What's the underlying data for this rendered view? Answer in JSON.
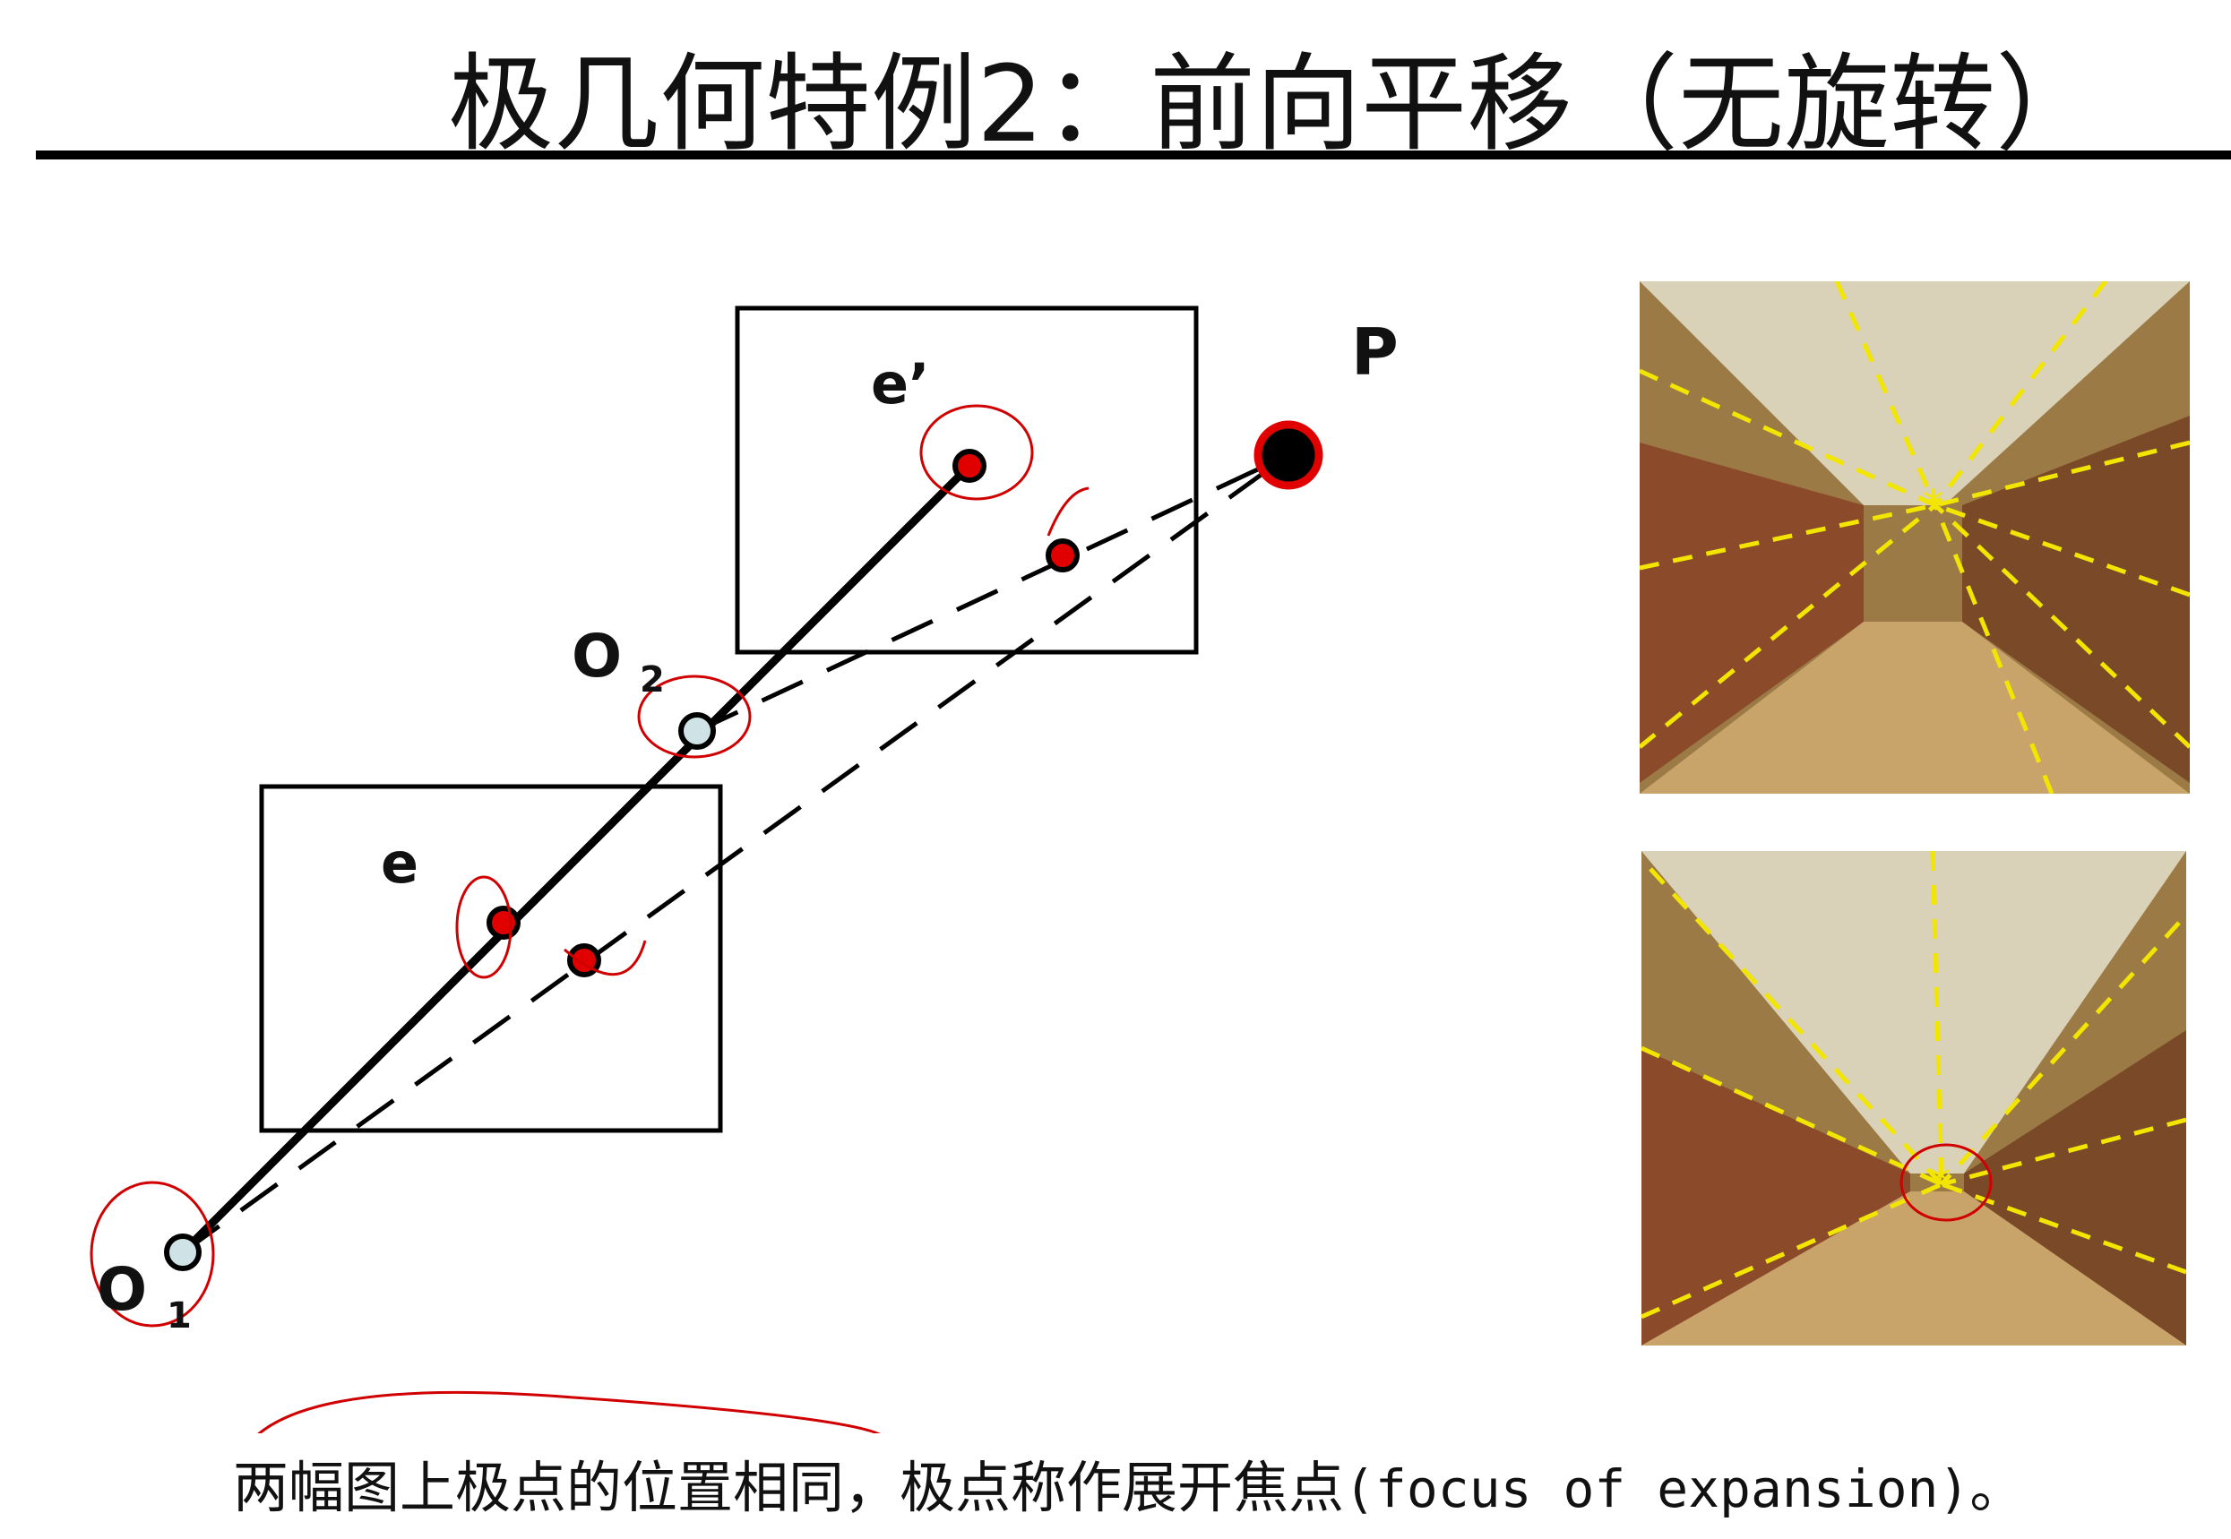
{
  "title": "极几何特例2：前向平移（无旋转）",
  "caption": {
    "cn": "两幅图上极点的位置相同，极点称作展开焦点",
    "en": "(focus of expansion)",
    "end": "。"
  },
  "labels": {
    "P": "P",
    "e_prime": "e’",
    "e": "e",
    "O2": "O",
    "O2_sub": "2",
    "O1": "O",
    "O1_sub": "1"
  },
  "colors": {
    "point": "#e00000",
    "camera": "#cfe3e6",
    "dash_overlay": "#f2e600"
  },
  "photos": [
    {
      "name": "hallway-image-1",
      "has_star": true
    },
    {
      "name": "hallway-image-2",
      "has_star": true,
      "circled": true
    }
  ]
}
